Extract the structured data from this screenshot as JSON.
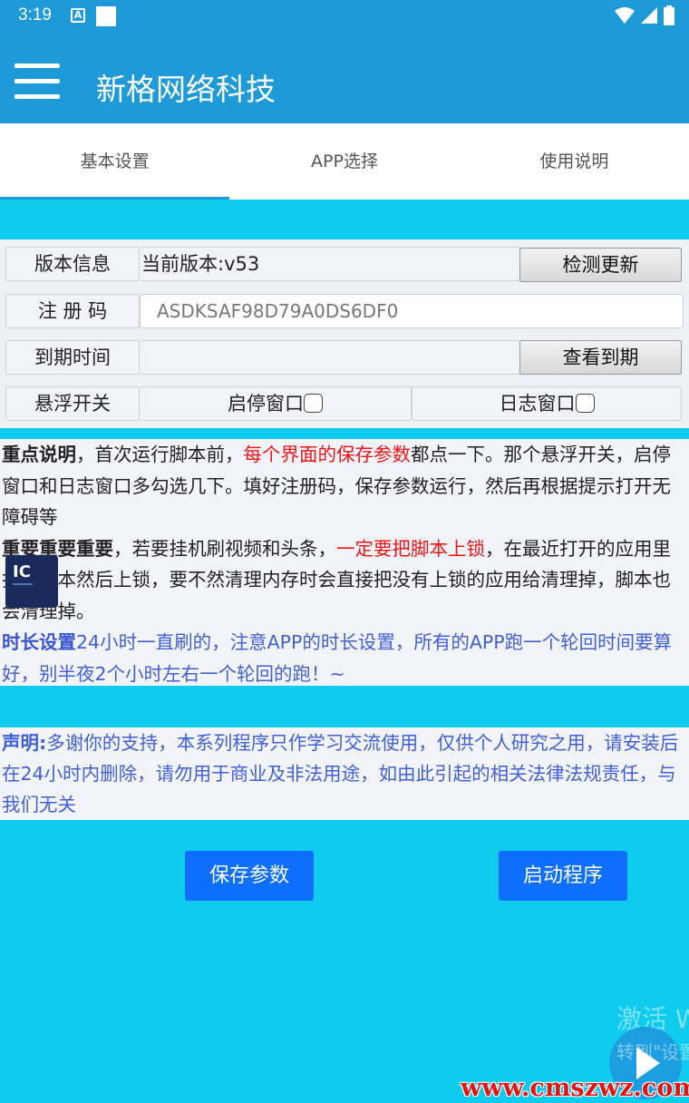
{
  "status": {
    "time": "3:19",
    "a_icon": "A"
  },
  "app_bar": {
    "title": "新格网络科技"
  },
  "tabs": [
    {
      "label": "基本设置"
    },
    {
      "label": "APP选择"
    },
    {
      "label": "使用说明"
    }
  ],
  "form": {
    "version_label": "版本信息",
    "version_value": "当前版本:v53",
    "check_update_button": "检测更新",
    "reg_label": "注 册 码",
    "reg_value": "ASDKSAF98D79A0DS6DF0",
    "expiry_label": "到期时间",
    "expiry_value": "",
    "view_expiry_button": "查看到期",
    "float_label": "悬浮开关",
    "start_stop_window": "启停窗口",
    "log_window": "日志窗口"
  },
  "notes": {
    "p1_bold": "重点说明",
    "p1_a": "，首次运行脚本前，",
    "p1_red": "每个界面的保存参数",
    "p1_b": "都点一下。那个悬浮开关，启停窗口和日志窗口多勾选几下。填好注册码，保存参数运行，然后再根据提示打开无障碍等",
    "p2_bold": "重要重要重要",
    "p2_a": "，若要挂机刷视频和头条，",
    "p2_red": "一定要把脚本上锁",
    "p2_b": "，在最近打开的应用里找到脚本然后上锁，要不然清理内存时会直接把没有上锁的应用给清理掉，脚本也会清理掉。",
    "p3_bold": "时长设置",
    "p3_text": "24小时一直刷的，注意APP的时长设置，所有的APP跑一个轮回时间要算好，别半夜2个小时左右一个轮回的跑！~"
  },
  "overlay_icon": {
    "text": "IC"
  },
  "statement": {
    "label": "声明:",
    "text": "多谢你的支持，本系列程序只作学习交流使用，仅供个人研究之用，请安装后在24小时内删除，请勿用于商业及非法用途，如由此引起的相关法律法规责任，与我们无关"
  },
  "buttons": {
    "save": "保存参数",
    "start": "启动程序"
  },
  "watermark": {
    "activate": "激活 W",
    "goto": "转到\"设置",
    "site": "www.cmszwz.com"
  },
  "colors": {
    "appbar": "#1e9ad9",
    "background": "#0fcbed",
    "accent_red": "#ee1515",
    "accent_blue": "#4060d8",
    "button_blue": "#0d6ffb"
  }
}
